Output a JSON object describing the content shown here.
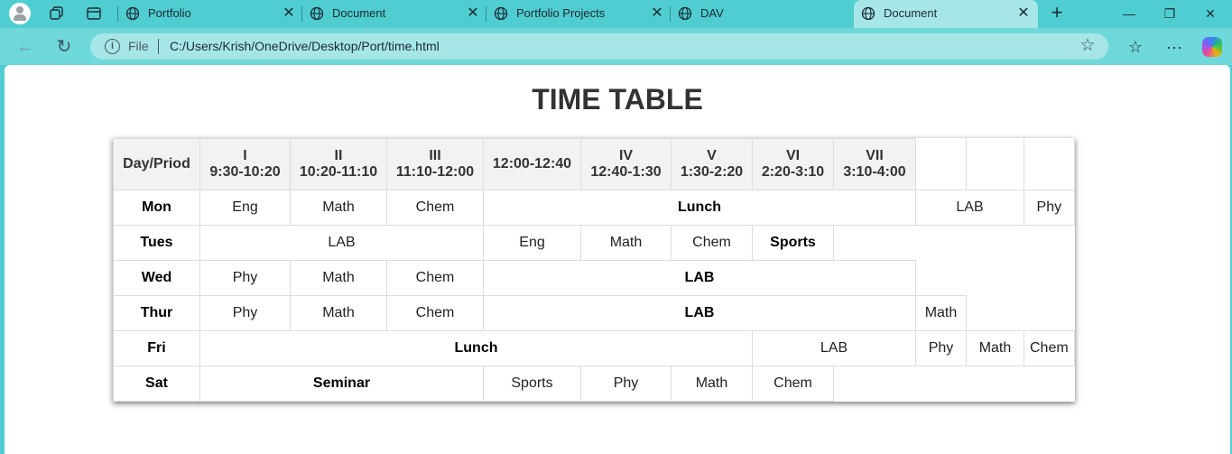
{
  "browser": {
    "tabs": [
      {
        "title": "Portfolio"
      },
      {
        "title": "Document"
      },
      {
        "title": "Portfolio Projects"
      },
      {
        "title": "DAV"
      },
      {
        "title": "Document"
      }
    ],
    "address": {
      "scheme_label": "File",
      "url": "C:/Users/Krish/OneDrive/Desktop/Port/time.html"
    }
  },
  "page": {
    "heading": "TIME TABLE",
    "header_cells": [
      {
        "roman": "",
        "time": "Day/Priod"
      },
      {
        "roman": "I",
        "time": "9:30-10:20"
      },
      {
        "roman": "II",
        "time": "10:20-11:10"
      },
      {
        "roman": "III",
        "time": "11:10-12:00"
      },
      {
        "roman": "",
        "time": "12:00-12:40"
      },
      {
        "roman": "IV",
        "time": "12:40-1:30"
      },
      {
        "roman": "V",
        "time": "1:30-2:20"
      },
      {
        "roman": "VI",
        "time": "2:20-3:10"
      },
      {
        "roman": "VII",
        "time": "3:10-4:00"
      }
    ],
    "rows": {
      "mon": {
        "day": "Mon",
        "c1": "Eng",
        "c2": "Math",
        "c3": "Chem",
        "c4": "Lunch",
        "c5": "LAB",
        "c6": "Phy"
      },
      "tue": {
        "day": "Tues",
        "c1": "LAB",
        "c2": "Eng",
        "c3": "Math",
        "c4": "Chem",
        "c5": "Sports"
      },
      "wed": {
        "day": "Wed",
        "c1": "Phy",
        "c2": "Math",
        "c3": "Chem",
        "c4": "LAB"
      },
      "thu": {
        "day": "Thur",
        "c1": "Phy",
        "c2": "Math",
        "c3": "Chem",
        "c4": "LAB",
        "c5": "Math"
      },
      "fri": {
        "day": "Fri",
        "c1": "Lunch",
        "c2": "LAB",
        "c3": "Phy",
        "c4": "Math",
        "c5": "Chem"
      },
      "sat": {
        "day": "Sat",
        "c1": "Seminar",
        "c2": "Sports",
        "c3": "Phy",
        "c4": "Math",
        "c5": "Chem"
      }
    }
  }
}
